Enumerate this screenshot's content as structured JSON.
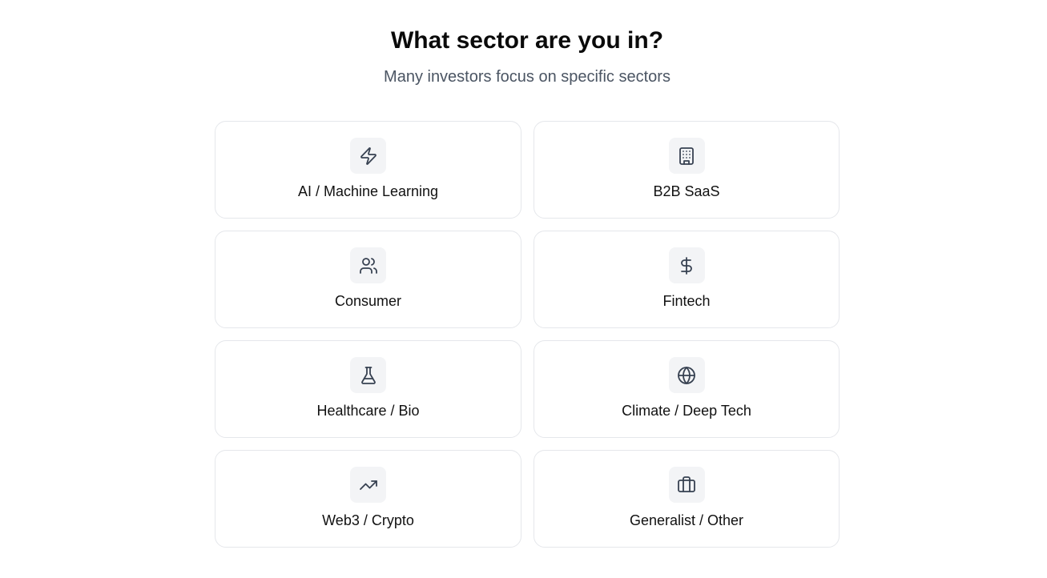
{
  "header": {
    "title": "What sector are you in?",
    "subtitle": "Many investors focus on specific sectors"
  },
  "sectors": [
    {
      "label": "AI / Machine Learning",
      "icon": "zap-icon"
    },
    {
      "label": "B2B SaaS",
      "icon": "building-icon"
    },
    {
      "label": "Consumer",
      "icon": "users-icon"
    },
    {
      "label": "Fintech",
      "icon": "dollar-sign-icon"
    },
    {
      "label": "Healthcare / Bio",
      "icon": "flask-icon"
    },
    {
      "label": "Climate / Deep Tech",
      "icon": "globe-icon"
    },
    {
      "label": "Web3 / Crypto",
      "icon": "trending-up-icon"
    },
    {
      "label": "Generalist / Other",
      "icon": "briefcase-icon"
    }
  ],
  "colors": {
    "card_border": "#e5e7eb",
    "icon_background": "#f3f4f6",
    "icon_stroke": "#374151",
    "subtitle_text": "#4b5563"
  }
}
